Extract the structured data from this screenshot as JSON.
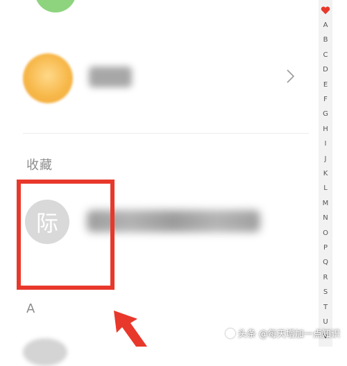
{
  "favorites_row": {
    "avatar_color": "#f7b84a"
  },
  "section_favorites": {
    "title": "收藏"
  },
  "contact": {
    "avatar_char": "际"
  },
  "section_a": {
    "title": "A"
  },
  "index_bar": {
    "heart_color": "#e8382b",
    "letters": [
      "A",
      "B",
      "C",
      "D",
      "E",
      "F",
      "G",
      "H",
      "I",
      "J",
      "K",
      "L",
      "M",
      "N",
      "O",
      "P",
      "Q",
      "R",
      "S",
      "T",
      "U",
      "V"
    ]
  },
  "highlight": {
    "box_color": "#e8382b"
  },
  "watermark": {
    "text": "头条 @每天增加一点知识"
  }
}
